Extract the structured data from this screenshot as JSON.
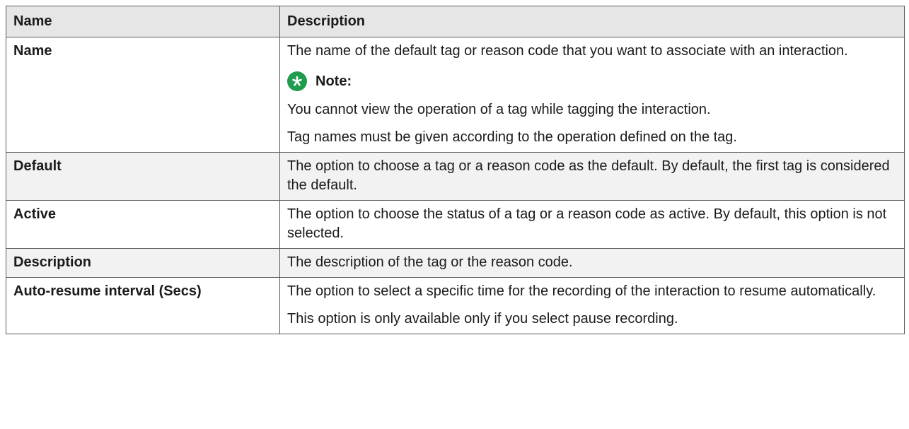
{
  "table": {
    "headers": [
      "Name",
      "Description"
    ],
    "rows": [
      {
        "name": "Name",
        "desc": "The name of the default tag or reason code that you want to associate with an interaction.",
        "note_label": "Note:",
        "note_icon": "asterisk-note-icon",
        "note_color": "#1f9c4e",
        "extra1": "You cannot view the operation of a tag while tagging the interaction.",
        "extra2": "Tag names must be given according to the operation defined on the tag."
      },
      {
        "name": "Default",
        "desc": "The option to choose a tag or a reason code as the default. By default, the first tag is considered the default."
      },
      {
        "name": "Active",
        "desc": "The option to choose the status of a tag or a reason code as active. By default, this option is not selected."
      },
      {
        "name": "Description",
        "desc": "The description of the tag or the reason code."
      },
      {
        "name": "Auto-resume interval (Secs)",
        "desc": "The option to select a specific time for the recording of the interaction to resume automatically.",
        "extra1": "This option is only available only if you select pause recording."
      }
    ]
  }
}
